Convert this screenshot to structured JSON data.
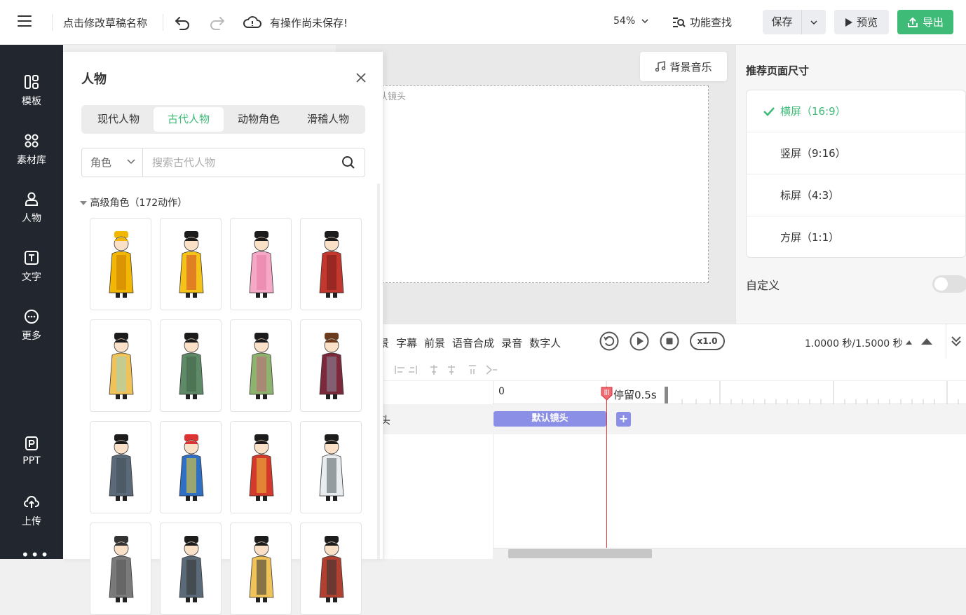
{
  "header": {
    "draft_name": "点击修改草稿名称",
    "save_status": "有操作尚未保存!",
    "zoom": "54%",
    "func_search": "功能查找",
    "save": "保存",
    "preview": "预览",
    "export": "导出"
  },
  "sidebar": {
    "items": [
      {
        "label": "模板",
        "icon": "template-icon"
      },
      {
        "label": "素材库",
        "icon": "material-icon"
      },
      {
        "label": "人物",
        "icon": "person-icon"
      },
      {
        "label": "文字",
        "icon": "text-icon"
      },
      {
        "label": "更多",
        "icon": "more-icon"
      },
      {
        "label": "PPT",
        "icon": "ppt-icon"
      },
      {
        "label": "上传",
        "icon": "upload-icon"
      }
    ]
  },
  "panel": {
    "title": "人物",
    "tabs": [
      "现代人物",
      "古代人物",
      "动物角色",
      "滑稽人物"
    ],
    "active_tab": 1,
    "select_value": "角色",
    "search_placeholder": "搜索古代人物",
    "group_title": "高级角色（172动作）"
  },
  "characters": [
    {
      "robe": "#f2b705",
      "hat": "#f2b705",
      "trim": "#c97a00"
    },
    {
      "robe": "#f4c219",
      "hat": "#1c1c1c",
      "trim": "#d04a2a"
    },
    {
      "robe": "#f6a9c7",
      "hat": "#1c1c1c",
      "trim": "#e37aa3"
    },
    {
      "robe": "#c2372e",
      "hat": "#1c1c1c",
      "trim": "#7a1e1a"
    },
    {
      "robe": "#f0c25a",
      "hat": "#1c1c1c",
      "trim": "#9fd3c0"
    },
    {
      "robe": "#5e8a67",
      "hat": "#1c1c1c",
      "trim": "#3f6347"
    },
    {
      "robe": "#8db36e",
      "hat": "#1c1c1c",
      "trim": "#c0667a"
    },
    {
      "robe": "#7c2a3b",
      "hat": "#6b3b1c",
      "trim": "#8a8aa0"
    },
    {
      "robe": "#5a6a78",
      "hat": "#1c1c1c",
      "trim": "#434e58"
    },
    {
      "robe": "#2f6fc4",
      "hat": "#d33",
      "trim": "#f2d12c"
    },
    {
      "robe": "#d33a2c",
      "hat": "#1c1c1c",
      "trim": "#f0c040"
    },
    {
      "robe": "#e8ecee",
      "hat": "#1c1c1c",
      "trim": "#4f5b60"
    },
    {
      "robe": "#7a7a7a",
      "hat": "#333",
      "trim": "#555"
    },
    {
      "robe": "#5a6a78",
      "hat": "#1c1c1c",
      "trim": "#333"
    },
    {
      "robe": "#f0c25a",
      "hat": "#1c1c1c",
      "trim": "#333"
    },
    {
      "robe": "#b04030",
      "hat": "#1c1c1c",
      "trim": "#333"
    }
  ],
  "canvas": {
    "bgm": "背景音乐",
    "stage_label": "认镜头"
  },
  "right_panel": {
    "title": "推荐页面尺寸",
    "sizes": [
      "横屏（16:9）",
      "竖屏（9:16）",
      "标屏（4:3）",
      "方屏（1:1）"
    ],
    "active_size": 0,
    "custom_label": "自定义",
    "custom_enabled": false
  },
  "timeline": {
    "tabs": [
      "景",
      "字幕",
      "前景",
      "语音合成",
      "录音",
      "数字人"
    ],
    "speed": "x1.0",
    "time_readout": "1.0000 秒/1.5000 秒",
    "ruler_zero": "0",
    "stay_label": "停留0.5s",
    "track_label": "头",
    "clip_label": "默认镜头",
    "add_label": "+"
  },
  "colors": {
    "accent": "#3dbb77",
    "sidebar_bg": "#21262f",
    "clip": "#8b8fe6",
    "playhead": "#e0303a"
  }
}
